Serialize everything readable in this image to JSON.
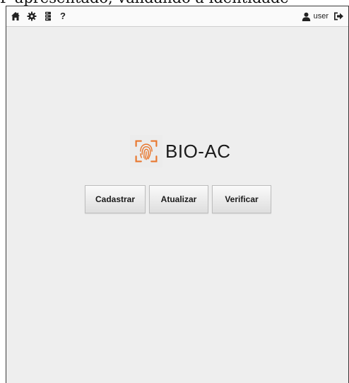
{
  "background_text": "P apresentado, validando a identidade",
  "navbar": {
    "icons": [
      "home-icon",
      "gear-icon",
      "server-icon",
      "help-icon"
    ],
    "help_label": "?",
    "user_label": "user"
  },
  "logo": {
    "text": "BIO-AC",
    "icon": "fingerprint-icon",
    "accent": "#e8772e"
  },
  "actions": {
    "register_label": "Cadastrar",
    "update_label": "Atualizar",
    "verify_label": "Verificar"
  },
  "colors": {
    "background": "#eeeeee",
    "navbar": "#fafafa",
    "accent": "#e8772e"
  }
}
